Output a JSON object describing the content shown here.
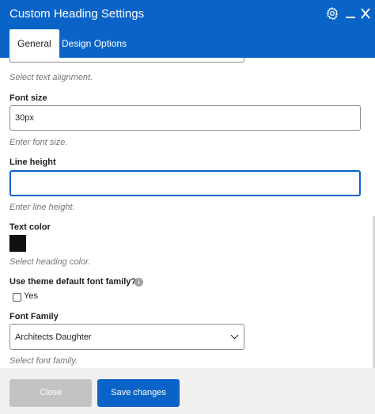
{
  "header": {
    "title": "Custom Heading Settings",
    "icons": {
      "settings": "gear-icon",
      "minimize": "minimize-icon",
      "close": "close-icon"
    },
    "accent_color": "#0a64c8"
  },
  "tabs": [
    {
      "label": "General",
      "active": true
    },
    {
      "label": "Design Options",
      "active": false
    }
  ],
  "fields": {
    "alignment_hint": "Select text alignment.",
    "font_size": {
      "label": "Font size",
      "value": "30px",
      "hint": "Enter font size."
    },
    "line_height": {
      "label": "Line height",
      "value": "",
      "hint": "Enter line height."
    },
    "text_color": {
      "label": "Text color",
      "value": "#111111",
      "hint": "Select heading color."
    },
    "theme_font": {
      "label": "Use theme default font family?",
      "option": "Yes",
      "checked": false
    },
    "font_family": {
      "label": "Font Family",
      "value": "Architects Daughter",
      "hint": "Select font family."
    }
  },
  "footer": {
    "close_label": "Close",
    "save_label": "Save changes"
  }
}
